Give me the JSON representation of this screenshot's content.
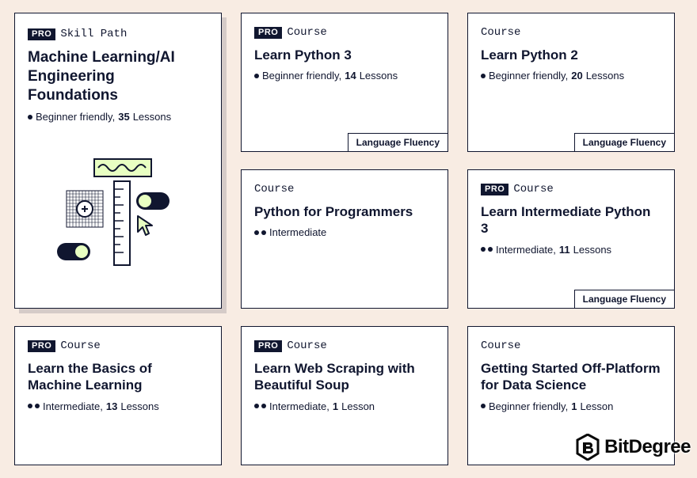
{
  "labels": {
    "pro": "PRO",
    "skill_path": "Skill Path",
    "course": "Course",
    "lessons": "Lessons",
    "lesson": "Lesson"
  },
  "cards": [
    {
      "pro": true,
      "type": "Skill Path",
      "title": "Machine Learning/AI Engineering Foundations",
      "level": "Beginner friendly",
      "level_dots": 1,
      "lessons": 35,
      "tag": null,
      "tall": true,
      "illustration": true
    },
    {
      "pro": true,
      "type": "Course",
      "title": "Learn Python 3",
      "level": "Beginner friendly",
      "level_dots": 1,
      "lessons": 14,
      "tag": "Language Fluency"
    },
    {
      "pro": false,
      "type": "Course",
      "title": "Learn Python 2",
      "level": "Beginner friendly",
      "level_dots": 1,
      "lessons": 20,
      "tag": "Language Fluency"
    },
    {
      "pro": false,
      "type": "Course",
      "title": "Python for Programmers",
      "level": "Intermediate",
      "level_dots": 2,
      "lessons": null,
      "tag": null
    },
    {
      "pro": true,
      "type": "Course",
      "title": "Learn Intermediate Python 3",
      "level": "Intermediate",
      "level_dots": 2,
      "lessons": 11,
      "tag": "Language Fluency"
    },
    {
      "pro": true,
      "type": "Course",
      "title": "Learn the Basics of Machine Learning",
      "level": "Intermediate",
      "level_dots": 2,
      "lessons": 13,
      "tag": null
    },
    {
      "pro": true,
      "type": "Course",
      "title": "Learn Web Scraping with Beautiful Soup",
      "level": "Intermediate",
      "level_dots": 2,
      "lessons": 1,
      "tag": null
    },
    {
      "pro": false,
      "type": "Course",
      "title": "Getting Started Off-Platform for Data Science",
      "level": "Beginner friendly",
      "level_dots": 1,
      "lessons": 1,
      "tag": null
    }
  ],
  "brand": "BitDegree"
}
